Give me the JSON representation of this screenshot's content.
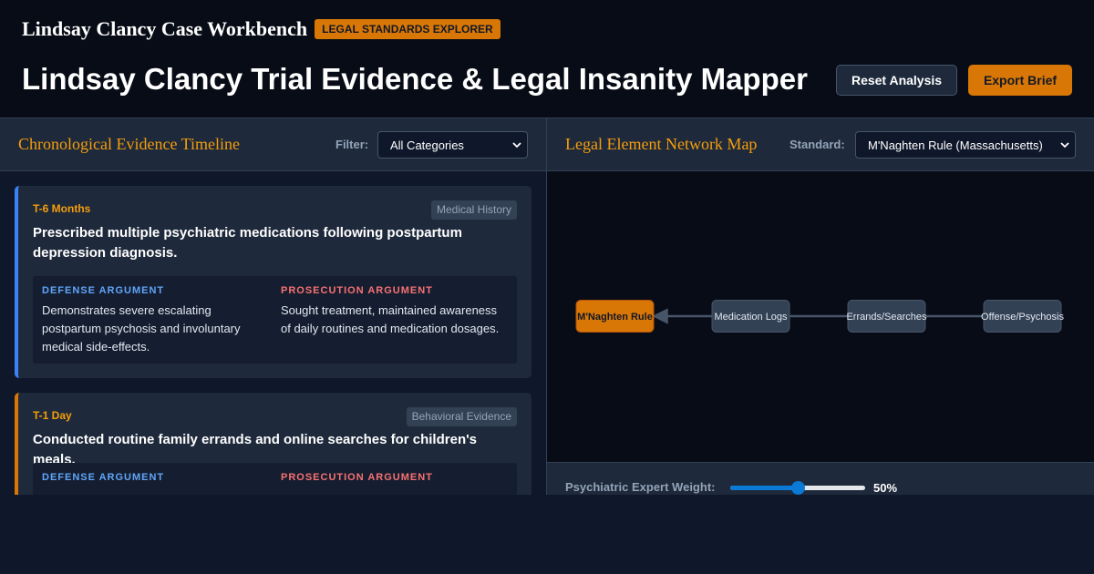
{
  "header": {
    "app_title": "Lindsay Clancy Case Workbench",
    "badge": "LEGAL STANDARDS EXPLORER",
    "page_title": "Lindsay Clancy Trial Evidence & Legal Insanity Mapper",
    "reset_label": "Reset Analysis",
    "export_label": "Export Brief"
  },
  "timeline": {
    "title": "Chronological Evidence Timeline",
    "filter_label": "Filter:",
    "filter_value": "All Categories",
    "cards": [
      {
        "time": "T-6 Months",
        "tag": "Medical History",
        "title": "Prescribed multiple psychiatric medications following postpartum depression diagnosis.",
        "defense_heading": "DEFENSE ARGUMENT",
        "defense_text": "Demonstrates severe escalating postpartum psychosis and involuntary medical side-effects.",
        "prosecution_heading": "PROSECUTION ARGUMENT",
        "prosecution_text": "Sought treatment, maintained awareness of daily routines and medication dosages."
      },
      {
        "time": "T-1 Day",
        "tag": "Behavioral Evidence",
        "title": "Conducted routine family errands and online searches for children's meals.",
        "defense_heading": "DEFENSE ARGUMENT",
        "prosecution_heading": "PROSECUTION ARGUMENT"
      }
    ]
  },
  "network": {
    "title": "Legal Element Network Map",
    "standard_label": "Standard:",
    "standard_value": "M'Naghten Rule (Massachusetts)",
    "nodes": [
      {
        "label": "M'Naghten Rule",
        "active": true
      },
      {
        "label": "Medication Logs",
        "active": false
      },
      {
        "label": "Errands/Searches",
        "active": false
      },
      {
        "label": "Offense/Psychosis",
        "active": false
      }
    ],
    "colors": {
      "active": "#d97706",
      "inactive": "#334155",
      "edge": "#475569"
    }
  },
  "weight": {
    "label": "Psychiatric Expert Weight:",
    "value_text": "50%",
    "value": 0.5
  }
}
